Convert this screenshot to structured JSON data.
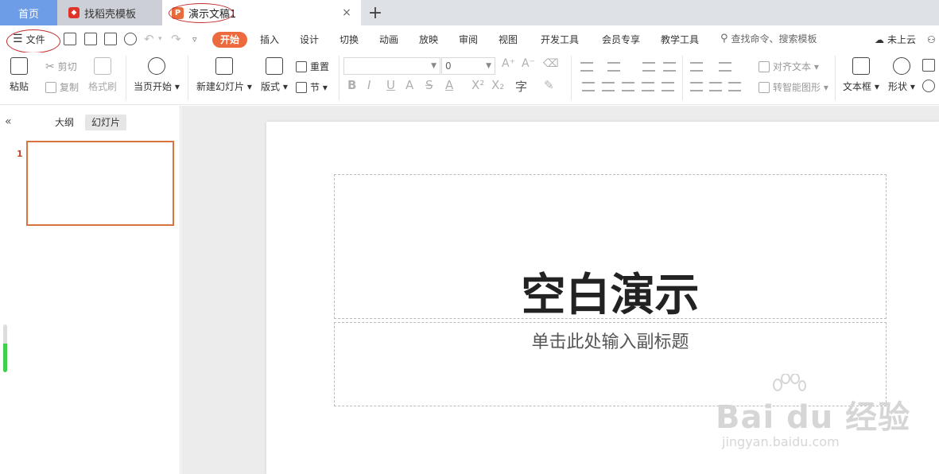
{
  "tabs": {
    "home": "首页",
    "template": "找稻壳模板",
    "doc": "演示文稿1",
    "close": "×",
    "add": "+"
  },
  "quick": {
    "file_menu": "文件",
    "menu_tabs": [
      "开始",
      "插入",
      "设计",
      "切换",
      "动画",
      "放映",
      "审阅",
      "视图",
      "开发工具",
      "会员专享",
      "教学工具"
    ],
    "search_placeholder": "查找命令、搜索模板",
    "cloud_status": "未上云"
  },
  "ribbon": {
    "paste": "粘贴",
    "cut": "剪切",
    "copy": "复制",
    "format_painter": "格式刷",
    "play_from_current": "当页开始",
    "new_slide": "新建幻灯片",
    "layout": "版式",
    "reset": "重置",
    "section": "节",
    "font_size_value": "0",
    "align_text": "对齐文本",
    "smart_art": "转智能图形",
    "text_box": "文本框",
    "shape": "形状"
  },
  "left_panel": {
    "tab_outline": "大纲",
    "tab_slides": "幻灯片",
    "slide_number": "1"
  },
  "slide": {
    "title": "空白演示",
    "subtitle": "单击此处输入副标题"
  },
  "watermark": {
    "brand": "Bai du 经验",
    "url": "jingyan.baidu.com"
  },
  "colors": {
    "accent": "#ec6a3d",
    "home_tab": "#6e9de8",
    "annotation": "#c42f2f"
  }
}
